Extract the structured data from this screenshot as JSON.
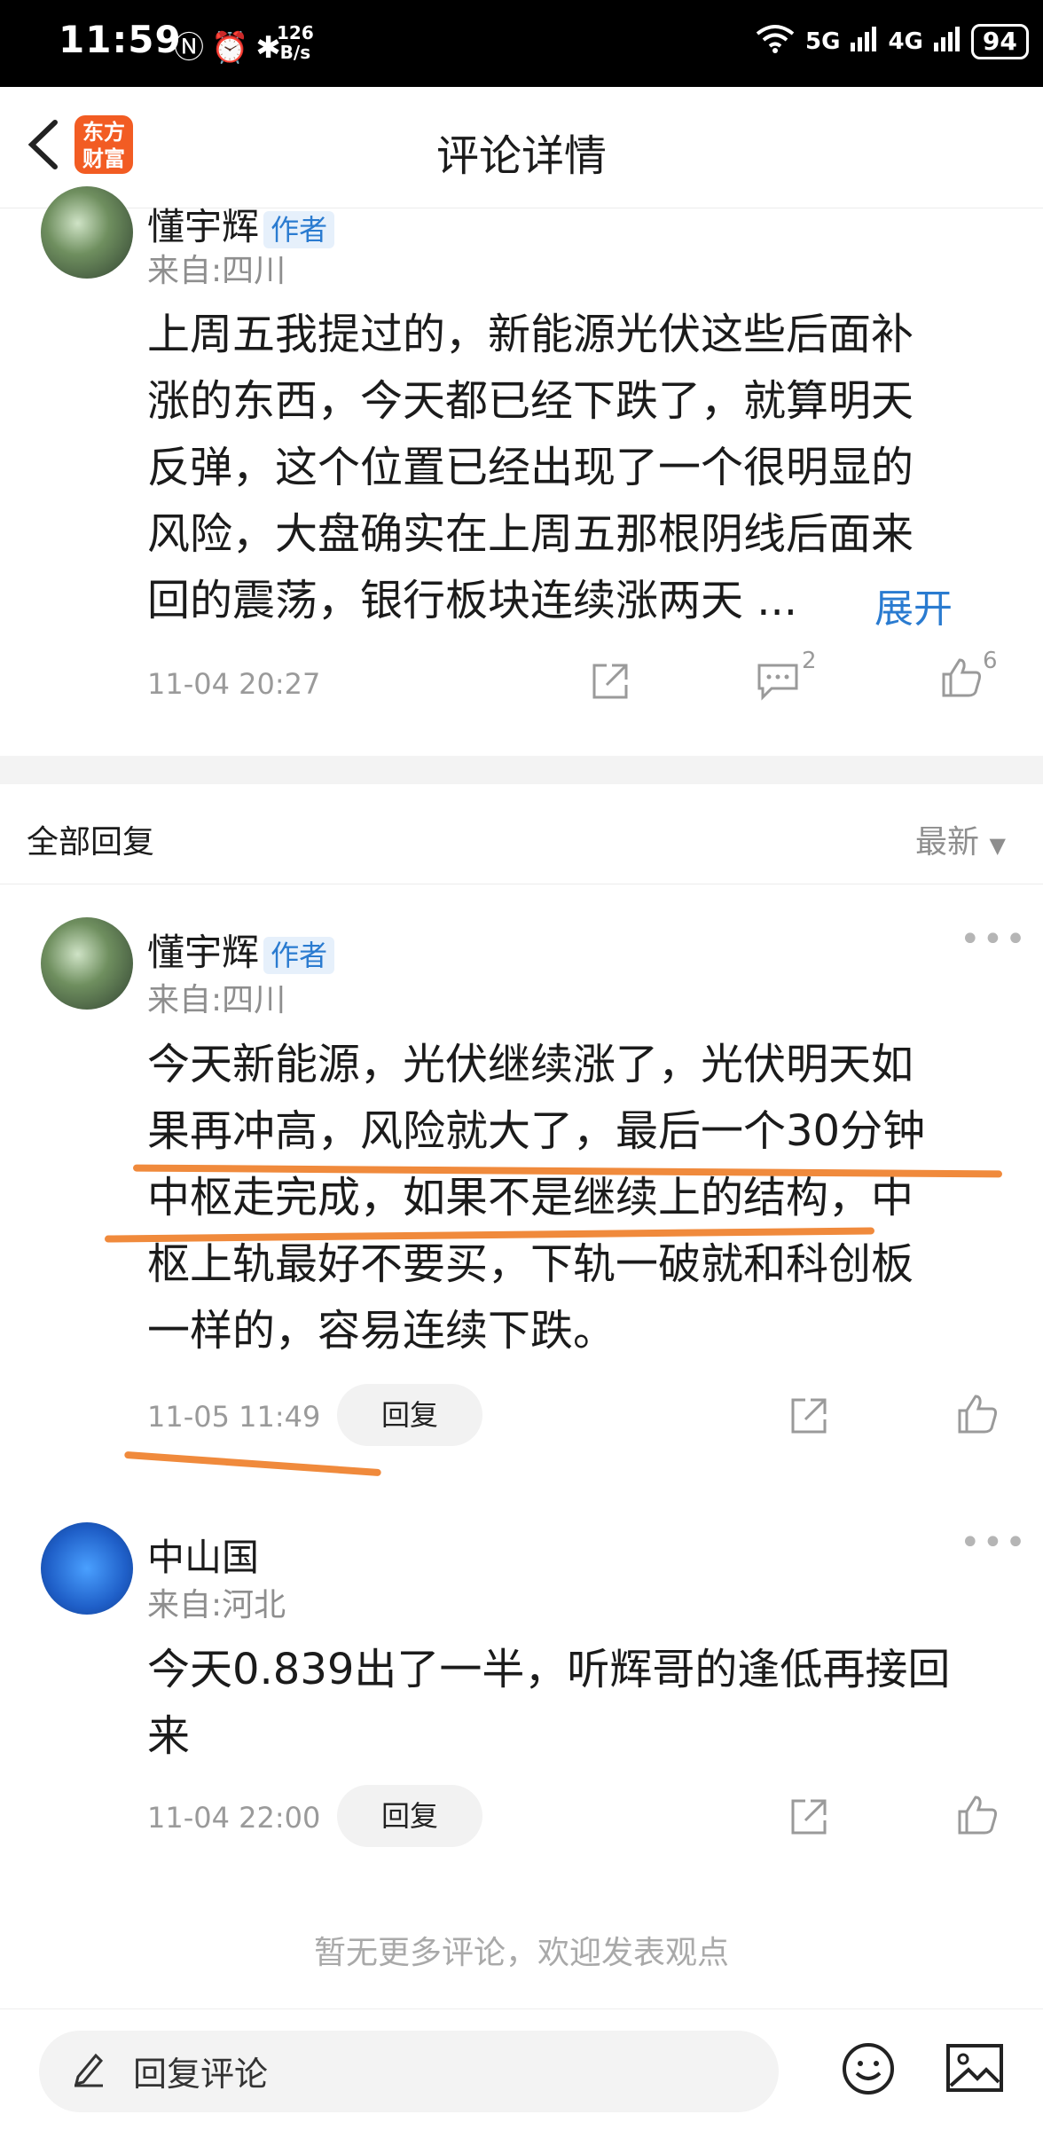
{
  "status_bar": {
    "time": "11:59",
    "network_speed_value": "126",
    "network_speed_unit": "B/s",
    "network_5g": "5G",
    "network_4g": "4G",
    "battery": "94"
  },
  "header": {
    "title": "评论详情",
    "logo_line1": "东方",
    "logo_line2": "财富"
  },
  "original_comment": {
    "author": "懂宇辉",
    "author_tag": "作者",
    "location": "来自:四川",
    "content_lines": [
      "上周五我提过的，新能源光伏这些后面补",
      "涨的东西，今天都已经下跌了，就算明天",
      "反弹，这个位置已经出现了一个很明显的",
      "风险，大盘确实在上周五那根阴线后面来",
      "回的震荡，银行板块连续涨两天 ..."
    ],
    "expand_label": "展开",
    "time": "11-04 20:27",
    "comment_count": "2",
    "like_count": "6"
  },
  "replies_section": {
    "title": "全部回复",
    "sort_label": "最新"
  },
  "replies": [
    {
      "author": "懂宇辉",
      "author_tag": "作者",
      "location": "来自:四川",
      "content_lines": [
        "今天新能源，光伏继续涨了，光伏明天如",
        "果再冲高，风险就大了，最后一个30分钟",
        "中枢走完成，如果不是继续上的结构，中",
        "枢上轨最好不要买，下轨一破就和科创板",
        "一样的，容易连续下跌。"
      ],
      "time": "11-05 11:49",
      "reply_label": "回复"
    },
    {
      "author": "中山国",
      "location": "来自:河北",
      "content_lines": [
        "今天0.839出了一半，听辉哥的逢低再接回",
        "来"
      ],
      "time": "11-04 22:00",
      "reply_label": "回复"
    }
  ],
  "footer_note": "暂无更多评论，欢迎发表观点",
  "bottom_bar": {
    "reply_placeholder": "回复评论"
  },
  "colors": {
    "brand_orange": "#f25c23",
    "link_blue": "#2a7bd0",
    "highlight_orange": "#f08a3c"
  }
}
